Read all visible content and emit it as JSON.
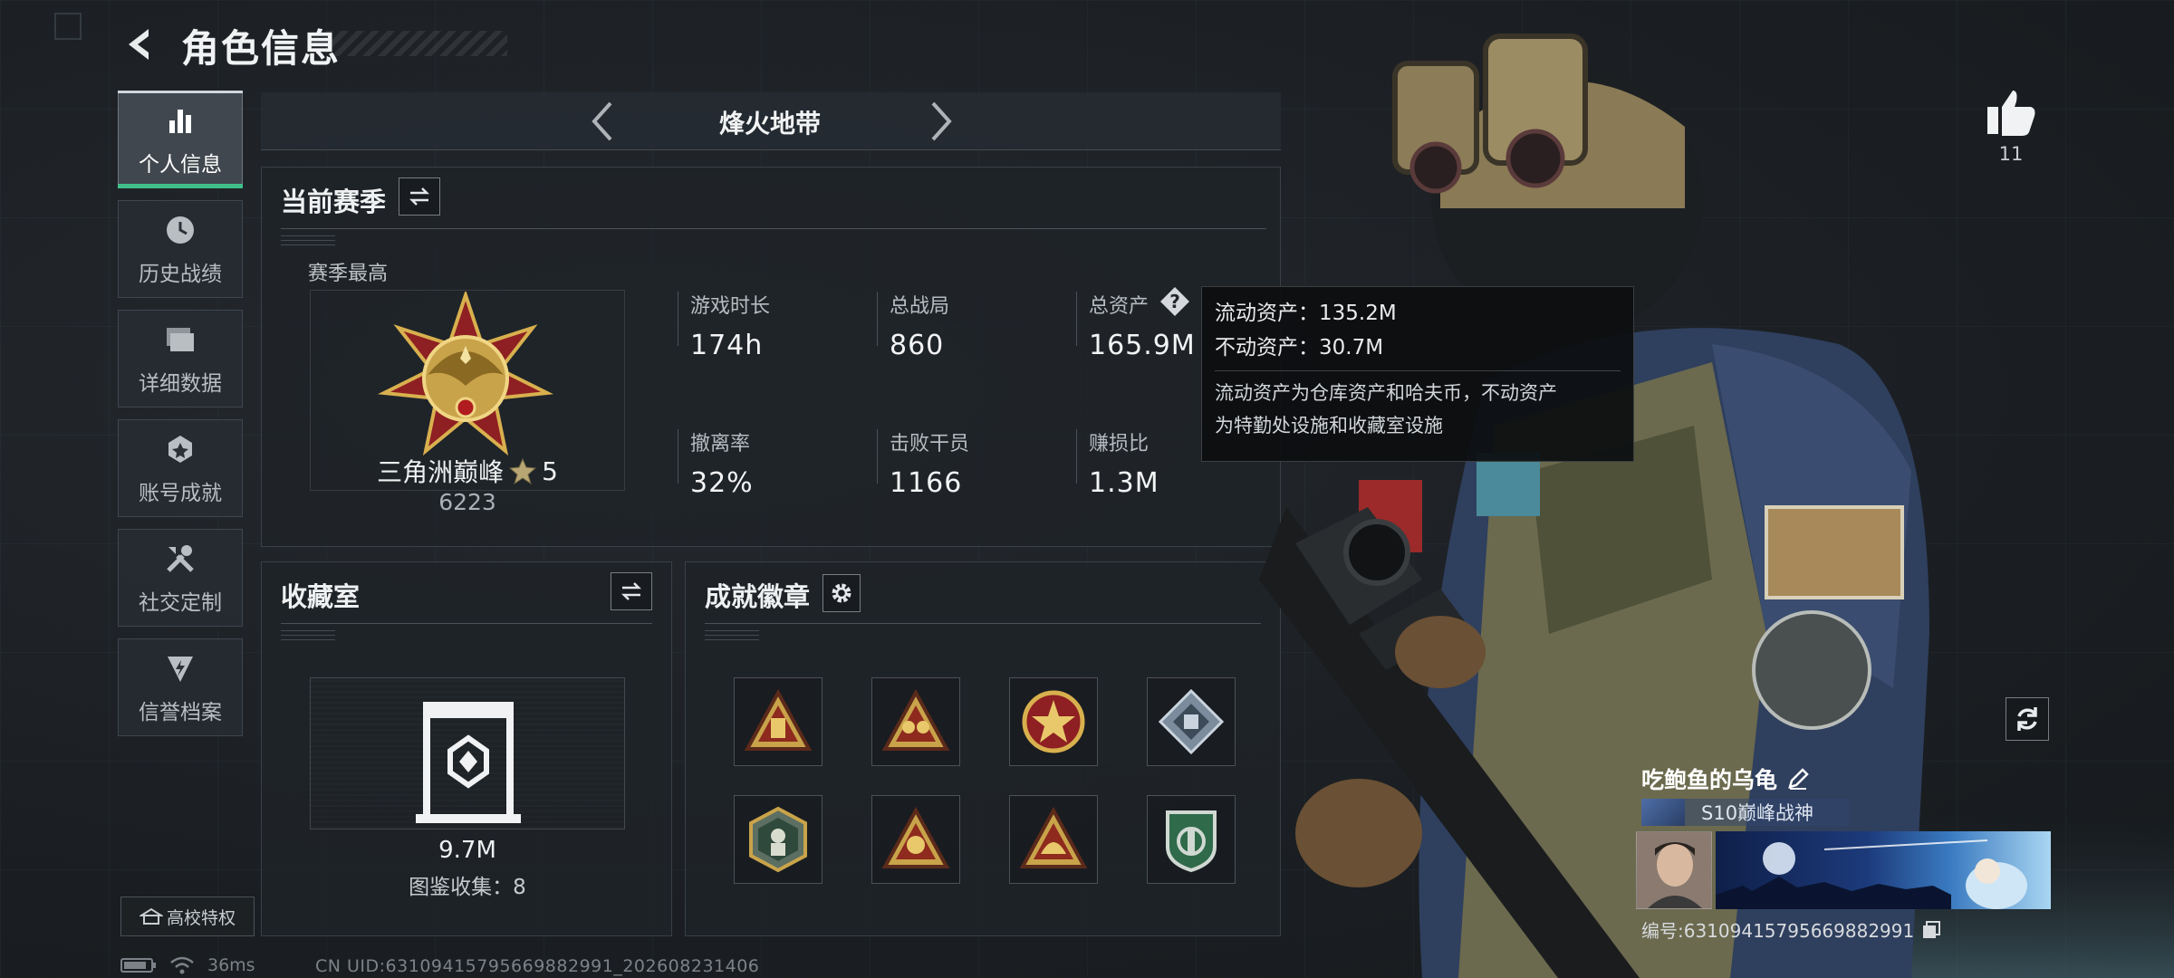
{
  "header": {
    "title": "角色信息"
  },
  "sidebar": {
    "items": [
      {
        "label": "个人信息",
        "icon": "bar-chart-icon"
      },
      {
        "label": "历史战绩",
        "icon": "history-icon"
      },
      {
        "label": "详细数据",
        "icon": "folder-icon"
      },
      {
        "label": "账号成就",
        "icon": "achievement-icon"
      },
      {
        "label": "社交定制",
        "icon": "tools-icon"
      },
      {
        "label": "信誉档案",
        "icon": "shield-icon"
      }
    ],
    "campus_label": "高校特权"
  },
  "mode": {
    "name": "烽火地带"
  },
  "season_panel": {
    "title": "当前赛季",
    "best_label": "赛季最高",
    "rank_name": "三角洲巅峰",
    "rank_stars": "5",
    "rank_score": "6223",
    "stats": [
      {
        "label": "游戏时长",
        "value": "174h"
      },
      {
        "label": "总战局",
        "value": "860"
      },
      {
        "label": "总资产",
        "value": "165.9M"
      },
      {
        "label": "撤离率",
        "value": "32%"
      },
      {
        "label": "击败干员",
        "value": "1166"
      },
      {
        "label": "赚损比",
        "value": "1.3M"
      }
    ]
  },
  "tooltip": {
    "liquid": "流动资产：135.2M",
    "fixed": "不动资产：30.7M",
    "desc_line1": "流动资产为仓库资产和哈夫币，不动资产",
    "desc_line2": "为特勤处设施和收藏室设施"
  },
  "collection_panel": {
    "title": "收藏室",
    "value": "9.7M",
    "count_label": "图鉴收集：8"
  },
  "badge_panel": {
    "title": "成就徽章",
    "badges": [
      "badge-1",
      "badge-2",
      "badge-3",
      "badge-4",
      "badge-5",
      "badge-6",
      "badge-7",
      "badge-8"
    ]
  },
  "player": {
    "likes": "11",
    "name": "吃鲍鱼的乌龟",
    "season_tag": "S10巅峰战神",
    "id_label": "编号:631094157956698829​91"
  },
  "status": {
    "ping": "36ms",
    "uid": "CN UID:631094157956698829​91_202608231406"
  },
  "colors": {
    "accent_green": "#3fc08a",
    "gold": "#c9a34a"
  }
}
